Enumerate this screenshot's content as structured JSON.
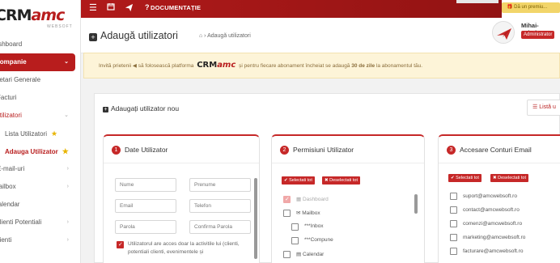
{
  "sidebar": {
    "logo": {
      "crm": "CRM",
      "amc": "amc",
      "sub": "WEBSOFT"
    },
    "items": [
      {
        "label": "Dashboard",
        "icon": "dashboard-icon"
      },
      {
        "label": "Companie",
        "active": true
      },
      {
        "label": "Setari Generale",
        "sub": true
      },
      {
        "label": "Facturi",
        "sub": true
      },
      {
        "label": "Utilizatori",
        "red": true
      },
      {
        "label": "Lista Utilizatori",
        "sub": true,
        "star": true
      },
      {
        "label": "Adauga Utilizator",
        "sub": true,
        "red": true,
        "star": true
      },
      {
        "label": "E-mail-uri"
      },
      {
        "label": "Mailbox"
      },
      {
        "label": "Calendar"
      },
      {
        "label": "Clienti Potentiali"
      },
      {
        "label": "Clienti"
      }
    ]
  },
  "topbar": {
    "doc_label": "DOCUMENTAȚIE",
    "promo": "Dă un premiu..."
  },
  "header": {
    "title": "Adaugă utilizatori",
    "breadcrumb": "Adaugă utilizatori",
    "user_name": "Mihai-Cristine",
    "user_role": "Administrator"
  },
  "banner": {
    "before": "Invită prietenii ",
    "middle": " să folosească platforma ",
    "after": " și pentru fiecare abonament încheiat se adaugă ",
    "bold": "30 de zile",
    "end": " la abonamentul tău."
  },
  "card": {
    "title": "Adaugați utilizator nou",
    "list_button": "Listă u"
  },
  "panel1": {
    "number": "1",
    "title": "Date Utilizator",
    "fields": {
      "nume": "Nume",
      "prenume": "Prenume",
      "email": "Email",
      "telefon": "Telefon",
      "parola": "Parola",
      "confirma": "Confirma Parola"
    },
    "checkbox_text": "Utilizatorul are acces doar la activitile lui (clienti, potentiali clienti, evenimentele și"
  },
  "panel2": {
    "number": "2",
    "title": "Permisiuni Utilizator",
    "select_all": "Selectati tot",
    "deselect_all": "Deselectati tot",
    "items": [
      {
        "label": "Dashboard",
        "icon": "dashboard-icon",
        "checked": true,
        "dim": true
      },
      {
        "label": "Mailbox",
        "icon": "mail-icon",
        "checked": false
      },
      {
        "label": "***Inbox",
        "checked": false,
        "indent": true
      },
      {
        "label": "***Compune",
        "checked": false,
        "indent": true
      },
      {
        "label": "Calendar",
        "icon": "calendar-icon",
        "checked": false
      }
    ]
  },
  "panel3": {
    "number": "3",
    "title": "Accesare Conturi Email",
    "select_all": "Selectati tot",
    "deselect_all": "Deselectati tot",
    "emails": [
      "suport@amcwebsoft.ro",
      "contact@amcwebsoft.ro",
      "comenzi@amcwebsoft.ro",
      "marketing@amcwebsoft.ro",
      "facturare@amcwebsoft.ro"
    ]
  }
}
